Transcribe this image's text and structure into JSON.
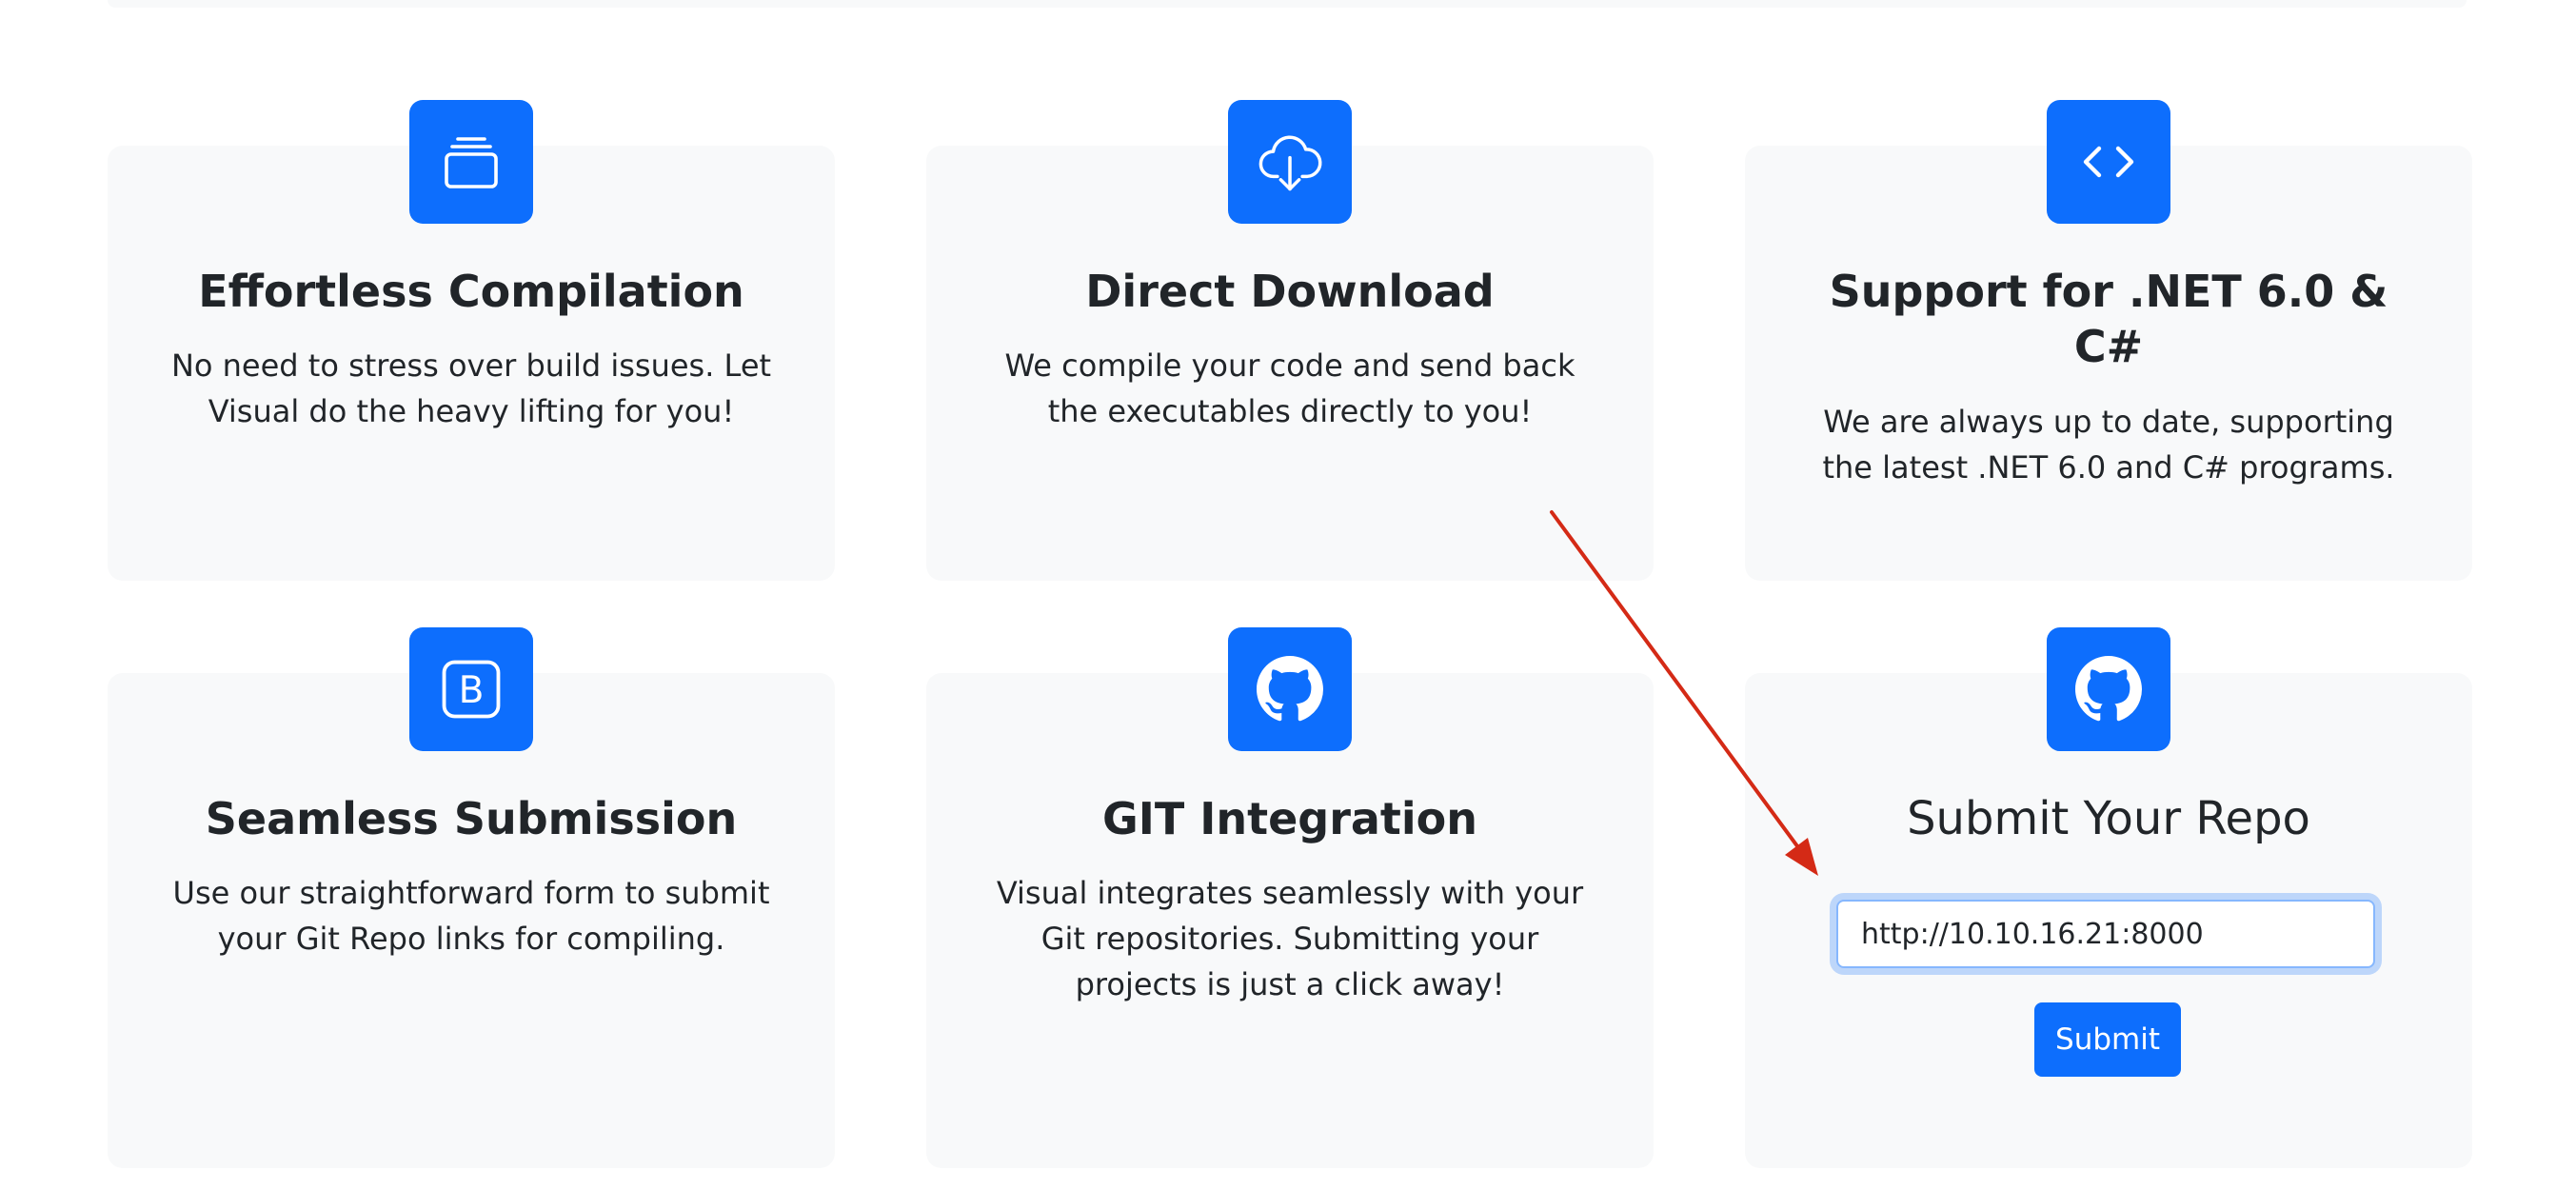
{
  "features": [
    {
      "icon": "stack-icon",
      "title": "Effortless Compilation",
      "text_lines": [
        "No need to stress over build issues. Let",
        "Visual do the heavy lifting for you!"
      ]
    },
    {
      "icon": "cloud-download-icon",
      "title": "Direct Download",
      "text_lines": [
        "We compile your code and send back",
        "the executables directly to you!"
      ]
    },
    {
      "icon": "code-icon",
      "title_lines": [
        "Support for .NET 6.0 &",
        "C#"
      ],
      "text_lines": [
        "We are always up to date, supporting",
        "the latest .NET 6.0 and C# programs."
      ]
    },
    {
      "icon": "bootstrap-icon",
      "title": "Seamless Submission",
      "text_lines": [
        "Use our straightforward form to submit",
        "your Git Repo links for compiling."
      ]
    },
    {
      "icon": "github-icon",
      "title": "GIT Integration",
      "text_lines": [
        "Visual integrates seamlessly with your",
        "Git repositories. Submitting your",
        "projects is just a click away!"
      ]
    }
  ],
  "submit_card": {
    "icon": "github-icon",
    "title": "Submit Your Repo",
    "input_value": "http://10.10.16.21:8000",
    "button_label": "Submit"
  },
  "colors": {
    "accent": "#0d6efd",
    "card_bg": "#f8f9fa",
    "annotation_arrow": "#d42a16"
  }
}
